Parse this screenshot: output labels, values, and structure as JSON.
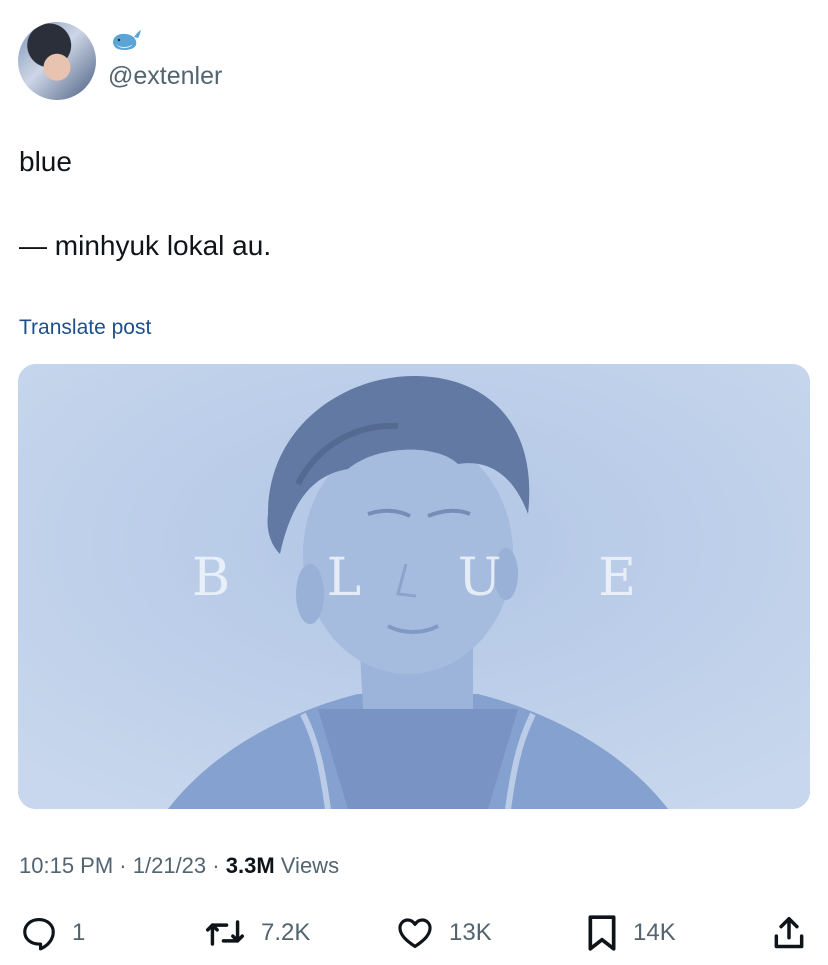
{
  "author": {
    "handle": "@extenler",
    "name_emoji": "whale-emoji"
  },
  "tweet": {
    "lines": [
      "blue",
      "— minhyuk lokal au."
    ],
    "translate_label": "Translate post"
  },
  "media": {
    "title_text": "B L U E",
    "tint_color": "#b6cbe6"
  },
  "meta": {
    "time": "10:15 PM",
    "date": "1/21/23",
    "views_count": "3.3M",
    "views_label": "Views",
    "separator": "·"
  },
  "actions": {
    "replies": "1",
    "reposts": "7.2K",
    "likes": "13K",
    "bookmarks": "14K"
  },
  "colors": {
    "text_primary": "#0f1419",
    "text_secondary": "#536471",
    "link": "#1d4f8c"
  }
}
